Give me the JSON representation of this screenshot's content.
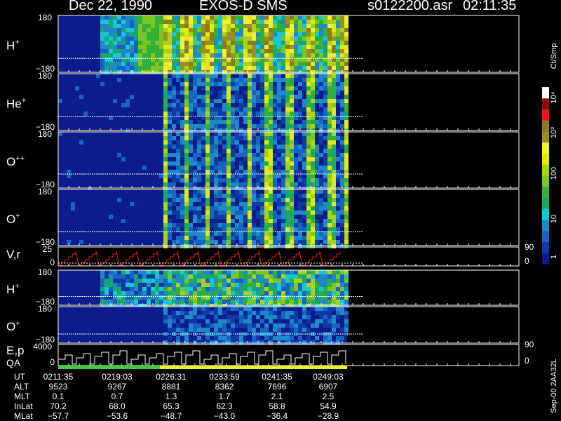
{
  "header": {
    "date": "Dec 22, 1990",
    "instrument": "EXOS-D SMS",
    "file": "s0122200.asr",
    "time": "02:11:35"
  },
  "footer_tag": "Sep-00 2AA32L",
  "chart_data": {
    "type": "heatmap",
    "title": "Dec 22, 1990   EXOS-D SMS",
    "colorbar": {
      "label": "Ct/Smp",
      "scale": "log",
      "range": [
        1,
        10000
      ],
      "ticks": [
        "1",
        "10",
        "100",
        "10³",
        "10⁴"
      ],
      "colors": [
        "#0d1c8c",
        "#0e3aa6",
        "#1565c0",
        "#1e88c8",
        "#19c6d6",
        "#1aa86a",
        "#34b03a",
        "#7cc522",
        "#aad21c",
        "#dfe818",
        "#f3ee3a",
        "#9a8f22",
        "#8a7a1a",
        "#e01d1d",
        "#8b0d0d",
        "#ffffff"
      ]
    },
    "panels": [
      {
        "label": "H",
        "sup": "+",
        "yticks": [
          "180",
          "−180"
        ],
        "ylim": [
          -180,
          180
        ]
      },
      {
        "label": "He",
        "sup": "+",
        "yticks": [
          "180",
          "−180"
        ],
        "ylim": [
          -180,
          180
        ]
      },
      {
        "label": "O",
        "sup": "++",
        "yticks": [
          "180",
          "−180"
        ],
        "ylim": [
          -180,
          180
        ]
      },
      {
        "label": "O",
        "sup": "+",
        "yticks": [
          "180",
          "−180"
        ],
        "ylim": [
          -180,
          180
        ]
      },
      {
        "label": "V,r",
        "sup": "",
        "yticks": [
          "25",
          "0"
        ],
        "ylim": [
          0,
          25
        ],
        "right_ticks": [
          "90",
          "0"
        ]
      },
      {
        "label": "H",
        "sup": "+",
        "yticks": [
          "180",
          "−180"
        ],
        "ylim": [
          -180,
          180
        ]
      },
      {
        "label": "O",
        "sup": "+",
        "yticks": [
          "180",
          "−180"
        ],
        "ylim": [
          -180,
          180
        ]
      },
      {
        "label": "E,p",
        "sup": "",
        "yticks": [
          "4000",
          "0"
        ],
        "ylim": [
          0,
          4000
        ],
        "right_ticks": [
          "90",
          "0"
        ]
      }
    ],
    "qa_label": "QA",
    "qa_segments": [
      {
        "from": "0211:35",
        "to": "0226:31",
        "color": "#3ccf3c"
      },
      {
        "from": "0226:31",
        "to": "0249:03",
        "color": "#f0f020"
      }
    ],
    "x_rows": [
      {
        "name": "UT",
        "values": [
          "0211:35",
          "0219:03",
          "0226:31",
          "0233:59",
          "0241:35",
          "0249:03"
        ]
      },
      {
        "name": "ALT",
        "values": [
          "9523",
          "9267",
          "8881",
          "8362",
          "7696",
          "6907"
        ]
      },
      {
        "name": "MLT",
        "values": [
          "0.1",
          "0.7",
          "1.3",
          "1.7",
          "2.1",
          "2.5"
        ]
      },
      {
        "name": "InLat",
        "values": [
          "70.2",
          "68.0",
          "65.3",
          "62.3",
          "58.8",
          "54.9"
        ]
      },
      {
        "name": "MLat",
        "values": [
          "−57.7",
          "−53.6",
          "−48.7",
          "−43.0",
          "−36.4",
          "−28.9"
        ]
      }
    ]
  }
}
